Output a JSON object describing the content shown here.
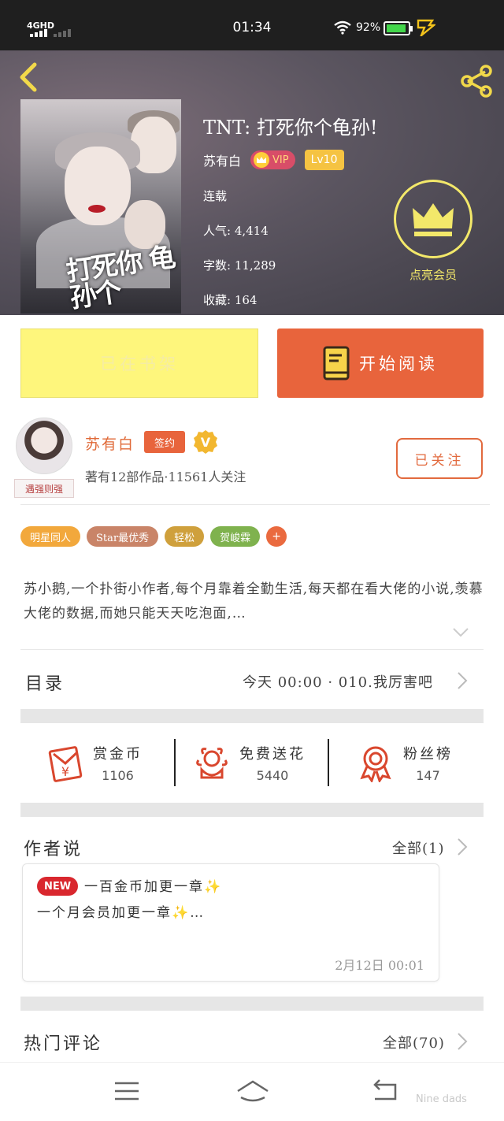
{
  "status_bar": {
    "network": "4GHD",
    "time": "01:34",
    "battery": "92%"
  },
  "book": {
    "title": "TNT: 打死你个龟孙!",
    "cover_title": "打死你 龟孙个",
    "author": "苏有白",
    "vip_label": "VIP",
    "level": "Lv10",
    "status": "连载",
    "popularity": "人气: 4,414",
    "words": "字数: 11,289",
    "favorites": "收藏: 164",
    "member_label": "点亮会员"
  },
  "actions": {
    "shelf": "已在书架",
    "read": "开始阅读"
  },
  "author_block": {
    "name": "苏有白",
    "signed": "签约",
    "avatar_tag": "遇强则强",
    "works": "著有12部作品·11561人关注",
    "follow": "已关注"
  },
  "tags": [
    {
      "label": "明星同人",
      "color": "#f2a83c"
    },
    {
      "label": "Star最优秀",
      "color": "#c98468"
    },
    {
      "label": "轻松",
      "color": "#cfa03c"
    },
    {
      "label": "贺峻霖",
      "color": "#7fb24e"
    }
  ],
  "tags_more": "+",
  "synopsis": "苏小鹅,一个扑街小作者,每个月靠着全勤生活,每天都在看大佬的小说,羡慕大佬的数据,而她只能天天吃泡面,…",
  "toc": {
    "title": "目录",
    "latest": "今天 00:00 · 010.我厉害吧"
  },
  "stats": [
    {
      "label": "赏金币",
      "value": "1106"
    },
    {
      "label": "免费送花",
      "value": "5440"
    },
    {
      "label": "粉丝榜",
      "value": "147"
    }
  ],
  "author_says": {
    "title": "作者说",
    "all": "全部(1)",
    "badge": "NEW",
    "line1": "一百金币加更一章✨",
    "line2": "一个月会员加更一章✨…",
    "date": "2月12日  00:01"
  },
  "hot_comments": {
    "title": "热门评论",
    "all": "全部(70)"
  },
  "watermark": "Nine dads",
  "colors": {
    "accent": "#e8643c",
    "shelf": "#fef67c",
    "gold": "#f3e86a"
  }
}
